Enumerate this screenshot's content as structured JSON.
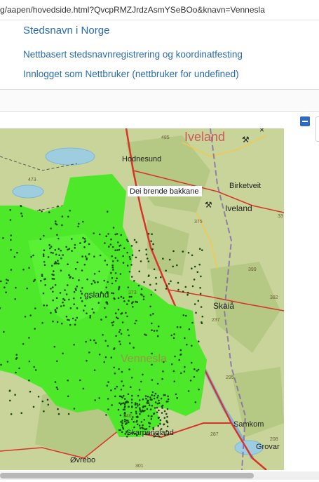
{
  "browser": {
    "url": "g/aapen/hovedside.html?QvcpRMZJrdzAsmYSeBOo&knavn=Vennesla"
  },
  "header": {
    "title": "Stedsnavn i Norge",
    "subtitle": "Nettbasert stedsnavnregistrering og koordinatfesting",
    "login_status": "Innlogget som Nettbruker (nettbruker for undefined)"
  },
  "map": {
    "colors": {
      "terrain": "#c9d49a",
      "forest": "#b5c984",
      "water": "#9ecde0",
      "cluster": "#4ee82a",
      "road": "#d8332a"
    },
    "places": [
      {
        "key": "iveland_big",
        "name": "Iveland"
      },
      {
        "key": "hodnesund",
        "name": "Hodnesund"
      },
      {
        "key": "dei_brende_bakkane",
        "name": "Dei brende bakkane"
      },
      {
        "key": "birketveit",
        "name": "Birketveit"
      },
      {
        "key": "iveland",
        "name": "Iveland"
      },
      {
        "key": "gsland",
        "name": "gsland"
      },
      {
        "key": "skaia",
        "name": "Skaiå"
      },
      {
        "key": "vennesla",
        "name": "Vennesla"
      },
      {
        "key": "samkom",
        "name": "Samkom"
      },
      {
        "key": "skarpengland",
        "name": "Skarpengland"
      },
      {
        "key": "grovane",
        "name": "Grovar"
      },
      {
        "key": "ovrebo",
        "name": "Øvrebo"
      }
    ],
    "elevations": [
      {
        "key": "e485",
        "value": "485"
      },
      {
        "key": "e473",
        "value": "473"
      },
      {
        "key": "e375",
        "value": "375"
      },
      {
        "key": "e373",
        "value": "373"
      },
      {
        "key": "e399",
        "value": "399"
      },
      {
        "key": "e382",
        "value": "382"
      },
      {
        "key": "e237",
        "value": "237"
      },
      {
        "key": "e295",
        "value": "295"
      },
      {
        "key": "e346",
        "value": "346"
      },
      {
        "key": "e287",
        "value": "287"
      },
      {
        "key": "e208",
        "value": "208"
      },
      {
        "key": "e301",
        "value": "301"
      },
      {
        "key": "e33",
        "value": "33"
      }
    ]
  }
}
